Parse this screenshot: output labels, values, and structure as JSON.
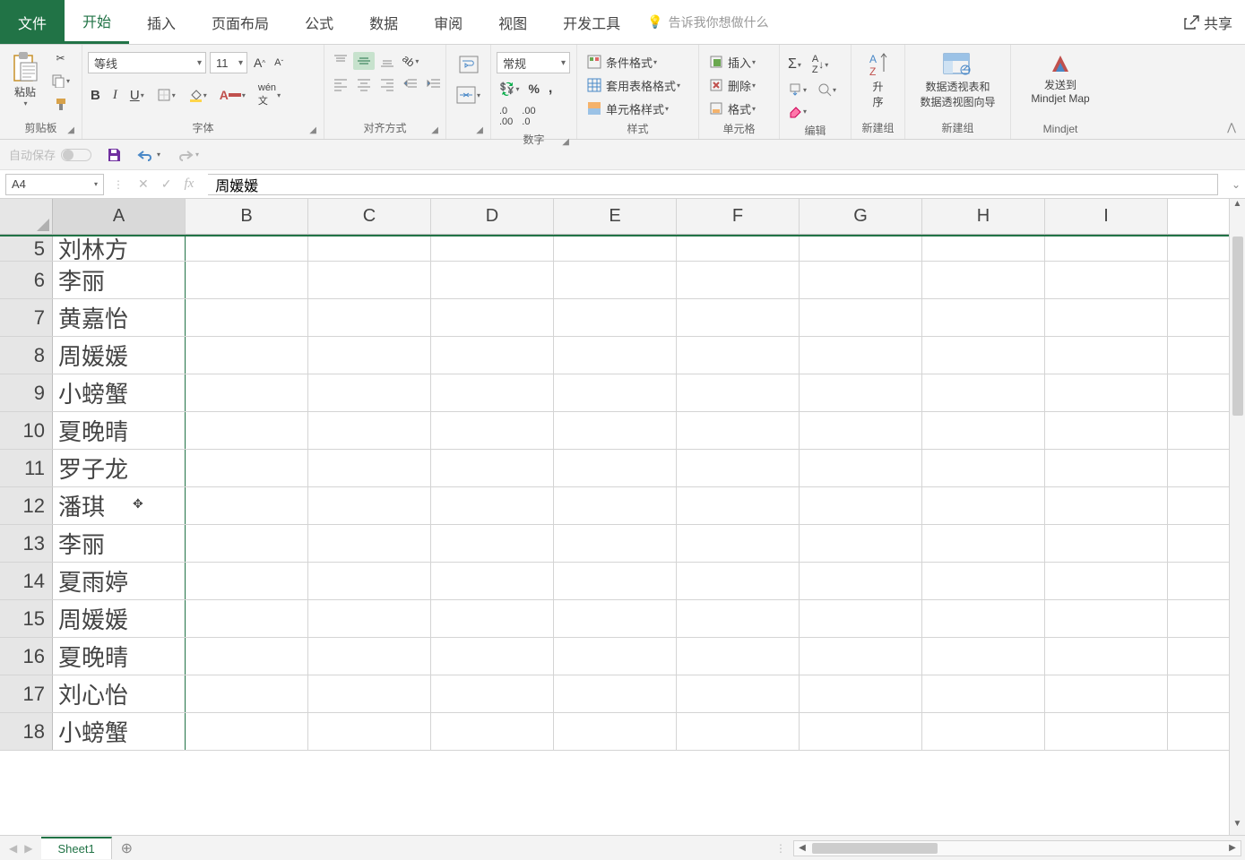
{
  "tabs": {
    "file": "文件",
    "home": "开始",
    "insert": "插入",
    "page_layout": "页面布局",
    "formulas": "公式",
    "data": "数据",
    "review": "审阅",
    "view": "视图",
    "developer": "开发工具",
    "tell_me": "告诉我你想做什么",
    "share": "共享"
  },
  "ribbon": {
    "clipboard": {
      "paste": "粘贴",
      "label": "剪贴板"
    },
    "font": {
      "name": "等线",
      "size": "11",
      "label": "字体"
    },
    "alignment": {
      "label": "对齐方式"
    },
    "number": {
      "format": "常规",
      "label": "数字"
    },
    "styles": {
      "cond_fmt": "条件格式",
      "format_table": "套用表格格式",
      "cell_styles": "单元格样式",
      "label": "样式"
    },
    "cells": {
      "insert": "插入",
      "delete": "删除",
      "format": "格式",
      "label": "单元格"
    },
    "editing": {
      "label": "编辑"
    },
    "sort": {
      "line1": "升",
      "line2": "序",
      "label": "新建组"
    },
    "pivot": {
      "line1": "数据透视表和",
      "line2": "数据透视图向导",
      "label": "新建组"
    },
    "mindjet": {
      "line1": "发送到",
      "line2": "Mindjet Map",
      "label": "Mindjet"
    }
  },
  "qat": {
    "autosave": "自动保存"
  },
  "formula_bar": {
    "name_box": "A4",
    "fx": "fx",
    "value": "周媛媛"
  },
  "columns": [
    "A",
    "B",
    "C",
    "D",
    "E",
    "F",
    "G",
    "H",
    "I"
  ],
  "rows": [
    {
      "num": "5",
      "a": "刘林方"
    },
    {
      "num": "6",
      "a": "李丽"
    },
    {
      "num": "7",
      "a": "黄嘉怡"
    },
    {
      "num": "8",
      "a": "周媛媛"
    },
    {
      "num": "9",
      "a": "小螃蟹"
    },
    {
      "num": "10",
      "a": "夏晚晴"
    },
    {
      "num": "11",
      "a": "罗子龙"
    },
    {
      "num": "12",
      "a": "潘琪"
    },
    {
      "num": "13",
      "a": "李丽"
    },
    {
      "num": "14",
      "a": "夏雨婷"
    },
    {
      "num": "15",
      "a": "周媛媛"
    },
    {
      "num": "16",
      "a": "夏晚晴"
    },
    {
      "num": "17",
      "a": "刘心怡"
    },
    {
      "num": "18",
      "a": "小螃蟹"
    }
  ],
  "footer": {
    "sheet_name": "Sheet1"
  }
}
